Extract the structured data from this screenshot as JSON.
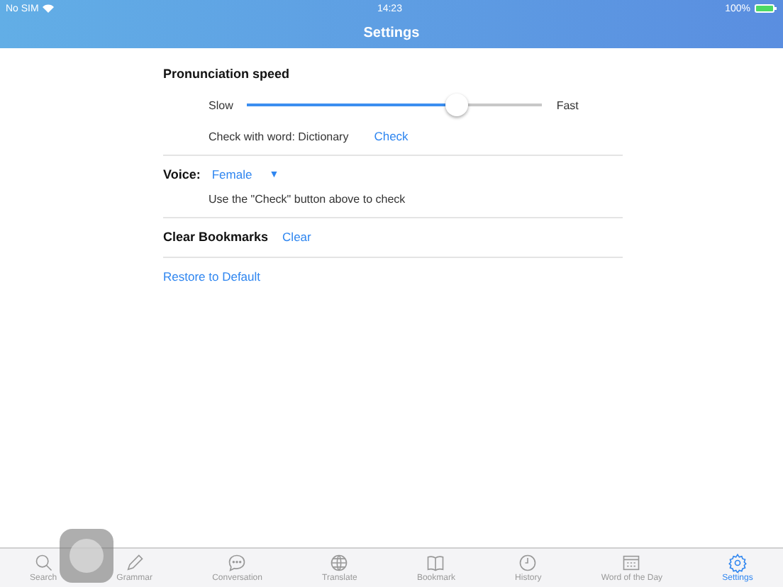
{
  "status_bar": {
    "carrier": "No SIM",
    "time": "14:23",
    "battery": "100%"
  },
  "nav": {
    "title": "Settings"
  },
  "speed": {
    "title": "Pronunciation speed",
    "min_label": "Slow",
    "max_label": "Fast",
    "level": 0.71,
    "check_text": "Check with word: Dictionary",
    "check_button": "Check"
  },
  "voice": {
    "label": "Voice:",
    "value": "Female",
    "caret": "▼",
    "hint": "Use the \"Check\" button above to check"
  },
  "bookmarks": {
    "label": "Clear Bookmarks",
    "button": "Clear"
  },
  "restore": "Restore to Default",
  "tabs": [
    {
      "kind": "search",
      "label": "Search",
      "selected": false
    },
    {
      "kind": "pencil",
      "label": "Grammar",
      "selected": false
    },
    {
      "kind": "chat",
      "label": "Conversation",
      "selected": false
    },
    {
      "kind": "globe",
      "label": "Translate",
      "selected": false
    },
    {
      "kind": "book",
      "label": "Bookmark",
      "selected": false
    },
    {
      "kind": "clock",
      "label": "History",
      "selected": false
    },
    {
      "kind": "calendar",
      "label": "Word of the Day",
      "selected": false
    },
    {
      "kind": "gear",
      "label": "Settings",
      "selected": true
    }
  ]
}
